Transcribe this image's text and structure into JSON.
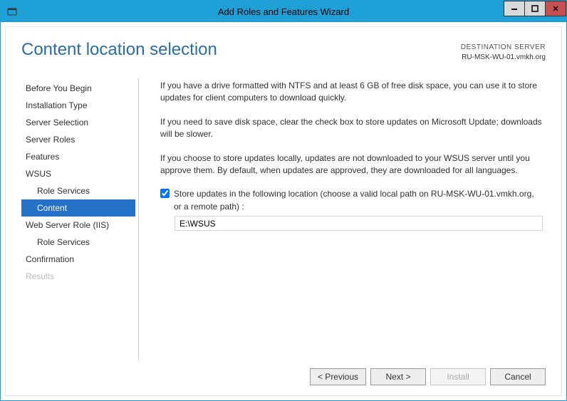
{
  "window": {
    "title": "Add Roles and Features Wizard"
  },
  "header": {
    "page_title": "Content location selection",
    "dest_label": "DESTINATION SERVER",
    "dest_value": "RU-MSK-WU-01.vmkh.org"
  },
  "sidebar": {
    "items": [
      {
        "label": "Before You Begin",
        "indent": false
      },
      {
        "label": "Installation Type",
        "indent": false
      },
      {
        "label": "Server Selection",
        "indent": false
      },
      {
        "label": "Server Roles",
        "indent": false
      },
      {
        "label": "Features",
        "indent": false
      },
      {
        "label": "WSUS",
        "indent": false
      },
      {
        "label": "Role Services",
        "indent": true
      },
      {
        "label": "Content",
        "indent": true,
        "selected": true
      },
      {
        "label": "Web Server Role (IIS)",
        "indent": false
      },
      {
        "label": "Role Services",
        "indent": true
      },
      {
        "label": "Confirmation",
        "indent": false
      },
      {
        "label": "Results",
        "indent": false,
        "disabled": true
      }
    ]
  },
  "main": {
    "para1": "If you have a drive formatted with NTFS and at least 6 GB of free disk space, you can use it to store updates for client computers to download quickly.",
    "para2": "If you need to save disk space, clear the check box to store updates on Microsoft Update; downloads will be slower.",
    "para3": "If you choose to store updates locally, updates are not downloaded to your WSUS server until you approve them. By default, when updates are approved, they are downloaded for all languages.",
    "checkbox_label": "Store updates in the following location (choose a valid local path on RU-MSK-WU-01.vmkh.org, or a remote path) :",
    "checkbox_checked": true,
    "path_value": "E:\\WSUS"
  },
  "footer": {
    "previous": "< Previous",
    "next": "Next >",
    "install": "Install",
    "cancel": "Cancel"
  }
}
